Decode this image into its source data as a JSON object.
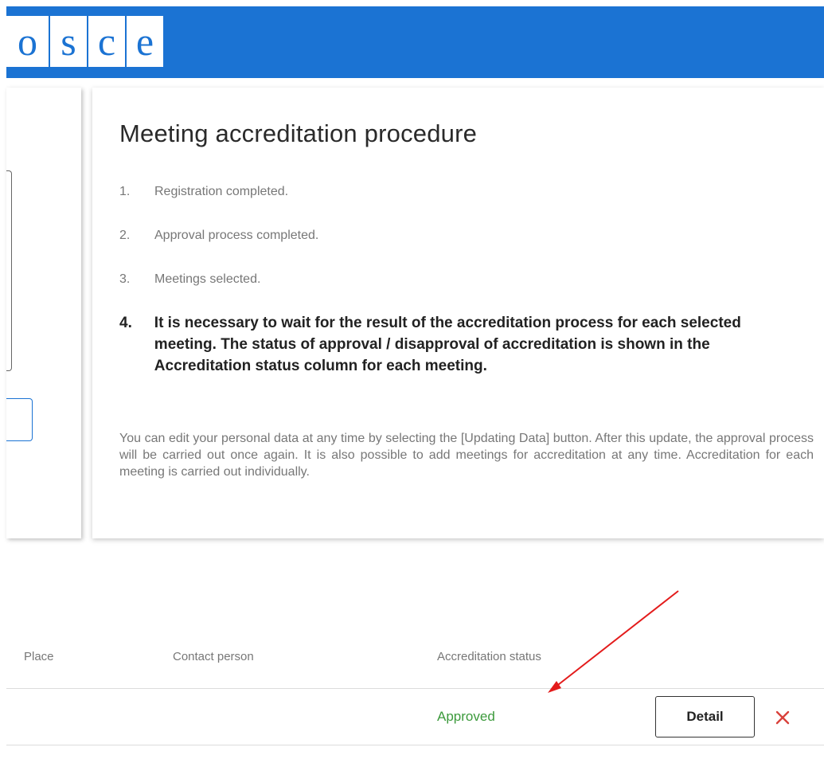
{
  "header": {
    "logo_letters": [
      "o",
      "s",
      "c",
      "e"
    ],
    "color": "#1b73d3"
  },
  "procedure": {
    "title": "Meeting accreditation procedure",
    "steps": [
      {
        "num": "1.",
        "text": "Registration completed."
      },
      {
        "num": "2.",
        "text": "Approval process completed."
      },
      {
        "num": "3.",
        "text": "Meetings selected."
      },
      {
        "num": "4.",
        "text": "It is necessary to wait for the result of the accreditation process for each selected meeting. The status of approval / disapproval of accreditation is shown in the Accreditation status column for each meeting."
      }
    ],
    "note": "You can edit your personal data at any time by selecting the [Updating Data] button. After this update, the approval process will be carried out once again. It is also possible to add meetings for accreditation at any time. Accreditation for each meeting is carried out individually."
  },
  "table": {
    "columns": {
      "place": "Place",
      "contact": "Contact person",
      "status": "Accreditation status"
    },
    "rows": [
      {
        "place": "",
        "contact": "",
        "status": "Approved",
        "detail_label": "Detail",
        "remove_icon": "close-icon"
      }
    ]
  },
  "colors": {
    "brand": "#1b73d3",
    "approved": "#3c9a3c",
    "remove": "#d9413b",
    "annotation_arrow": "#e31b1b"
  }
}
